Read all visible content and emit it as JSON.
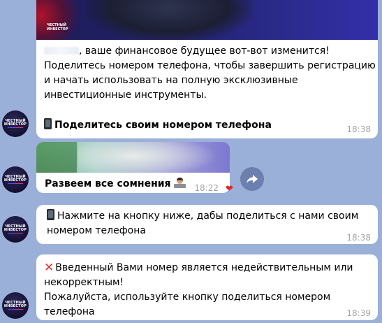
{
  "chat": {
    "avatar_label": "ЧЕСТНЫЙ ИНВЕСТОР",
    "messages": [
      {
        "media_caption": "ЧЕСТНЫЙ ИНВЕСТОР",
        "text_after_name": ", ваше финансовое будущее вот-вот изменится!",
        "text_line2": "Поделитесь номером телефона, чтобы завершить регистрацию",
        "text_line3": "и начать использовать на полную эксклюзивные",
        "text_line4": "инвестиционные инструменты.",
        "cta": "Поделитесь своим номером телефона",
        "cta_icon": "mobile-phone-icon",
        "time": "18:38"
      },
      {
        "caption": "Развеем все сомнения",
        "caption_icon": "technologist-emoji-icon",
        "time": "18:22",
        "reaction": "❤"
      },
      {
        "icon": "mobile-phone-icon",
        "text_line1": "Нажмите на кнопку ниже, дабы поделиться с нами своим",
        "text_line2": "номером телефона",
        "time": "18:38"
      },
      {
        "icon": "cross-mark-icon",
        "text_line1": "Введенный Вами номер является недействительным или",
        "text_line2": "некорректным!",
        "text_line3": "Пожалуйста, используйте кнопку поделиться номером телефона",
        "time": "18:39"
      }
    ]
  },
  "colors": {
    "background": "#9bb0d9",
    "bubble": "#ffffff",
    "time": "#a5a5a5",
    "cross": "#e1302f",
    "heart": "#e8242a"
  }
}
